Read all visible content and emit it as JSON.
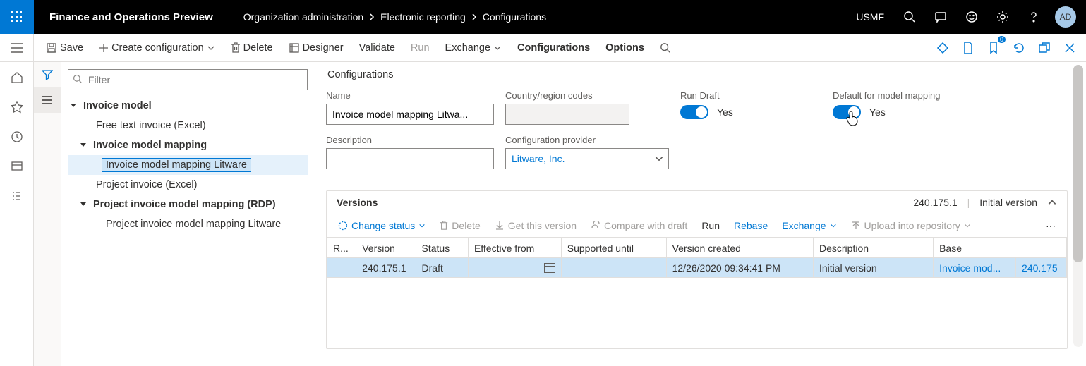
{
  "header": {
    "app_name": "Finance and Operations Preview",
    "breadcrumbs": [
      "Organization administration",
      "Electronic reporting",
      "Configurations"
    ],
    "legal_entity": "USMF",
    "avatar_initials": "AD"
  },
  "commandbar": {
    "save": "Save",
    "create": "Create configuration",
    "delete": "Delete",
    "designer": "Designer",
    "validate": "Validate",
    "run": "Run",
    "exchange": "Exchange",
    "configurations": "Configurations",
    "options": "Options"
  },
  "filter": {
    "placeholder": "Filter"
  },
  "tree": {
    "root": "Invoice model",
    "n1": "Free text invoice (Excel)",
    "n2": "Invoice model mapping",
    "n2a": "Invoice model mapping Litware",
    "n3": "Project invoice (Excel)",
    "n4": "Project invoice model mapping (RDP)",
    "n4a": "Project invoice model mapping Litware"
  },
  "details": {
    "section": "Configurations",
    "name_label": "Name",
    "name_value": "Invoice model mapping Litwa...",
    "desc_label": "Description",
    "desc_value": "",
    "crc_label": "Country/region codes",
    "crc_value": "",
    "provider_label": "Configuration provider",
    "provider_value": "Litware, Inc.",
    "rundraft_label": "Run Draft",
    "rundraft_value": "Yes",
    "default_label": "Default for model mapping",
    "default_value": "Yes"
  },
  "versions": {
    "title": "Versions",
    "summary_version": "240.175.1",
    "summary_desc": "Initial version",
    "toolbar": {
      "change_status": "Change status",
      "delete": "Delete",
      "get": "Get this version",
      "compare": "Compare with draft",
      "run": "Run",
      "rebase": "Rebase",
      "exchange": "Exchange",
      "upload": "Upload into repository"
    },
    "columns": {
      "r": "R...",
      "version": "Version",
      "status": "Status",
      "effective": "Effective from",
      "supported": "Supported until",
      "created": "Version created",
      "desc": "Description",
      "base": "Base"
    },
    "row": {
      "version": "240.175.1",
      "status": "Draft",
      "effective": "",
      "supported": "",
      "created": "12/26/2020 09:34:41 PM",
      "desc": "Initial version",
      "base_name": "Invoice mod...",
      "base_ver": "240.175"
    }
  }
}
